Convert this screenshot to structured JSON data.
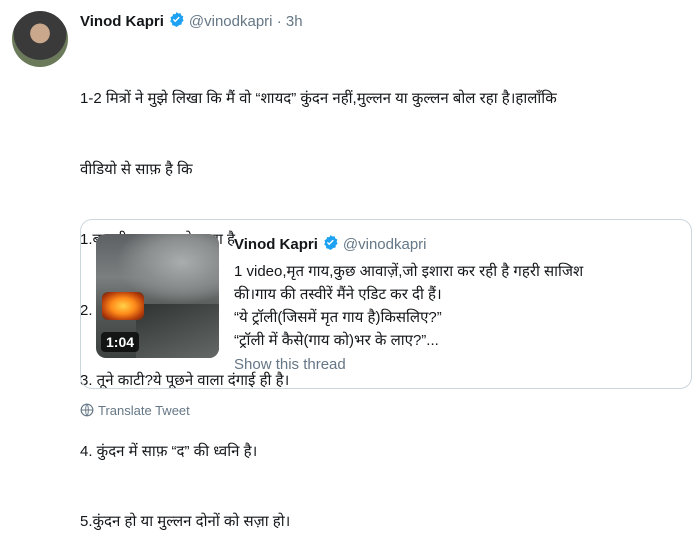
{
  "tweet": {
    "author_name": "Vinod Kapri",
    "handle": "@vinodkapri",
    "separator": "·",
    "time": "3h",
    "text_lines": [
      "1-2 मित्रों ने मुझे लिखा कि मैं वो “शायद” कुंदन नहीं,मुल्लन या कुल्लन बोल रहा है।हालाँकि",
      "वीडियो से साफ़ है कि",
      "1.बातचीत एकदम दोस्ताना है",
      "2. कुंदन भी वहीं मौजूद है",
      "3. तूने काटी?ये पूछने वाला दंगाई ही है।",
      "4. कुंदन में साफ़ “द” की ध्वनि है।",
      "5.कुंदन हो या मुल्लन दोनों को  सज़ा हो।"
    ]
  },
  "quoted_tweet": {
    "author_name": "Vinod Kapri",
    "handle": "@vinodkapri",
    "video_duration": "1:04",
    "text_lines": [
      "1 video,मृत गाय,कुछ आवाज़ें,जो इशारा कर रही है गहरी साजिश",
      "की।गाय की तस्वीरें मैंने एडिट कर दी हैं।",
      "“ये ट्रॉली(जिसमें मृत गाय है)किसलिए?”",
      "“ट्रॉली में कैसे(गाय को)भर के लाए?”..."
    ],
    "show_thread": "Show this thread"
  },
  "translate": {
    "label": "Translate Tweet",
    "icon": "globe-icon"
  },
  "colors": {
    "verified": "#1da1f2",
    "muted": "#657786",
    "border": "#ccd6dd"
  }
}
